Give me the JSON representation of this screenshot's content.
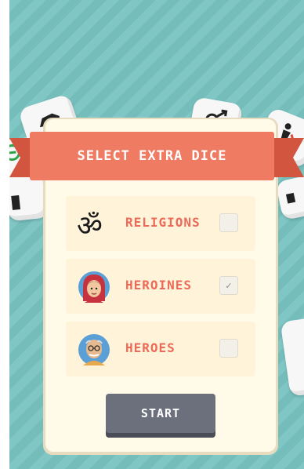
{
  "dialog": {
    "title": "SELECT EXTRA DICE",
    "options": [
      {
        "label": "RELIGIONS",
        "checked": false,
        "icon": "om-icon"
      },
      {
        "label": "HEROINES",
        "checked": true,
        "check_mark": "✓",
        "icon": "heroine-avatar-icon"
      },
      {
        "label": "HEROES",
        "checked": false,
        "icon": "hero-avatar-icon"
      }
    ],
    "start_label": "START"
  },
  "colors": {
    "background": "#7fc6c4",
    "ribbon": "#ee7b62",
    "panel": "#fffbe8",
    "label": "#ec6a58",
    "start_button": "#6c6f7c"
  }
}
